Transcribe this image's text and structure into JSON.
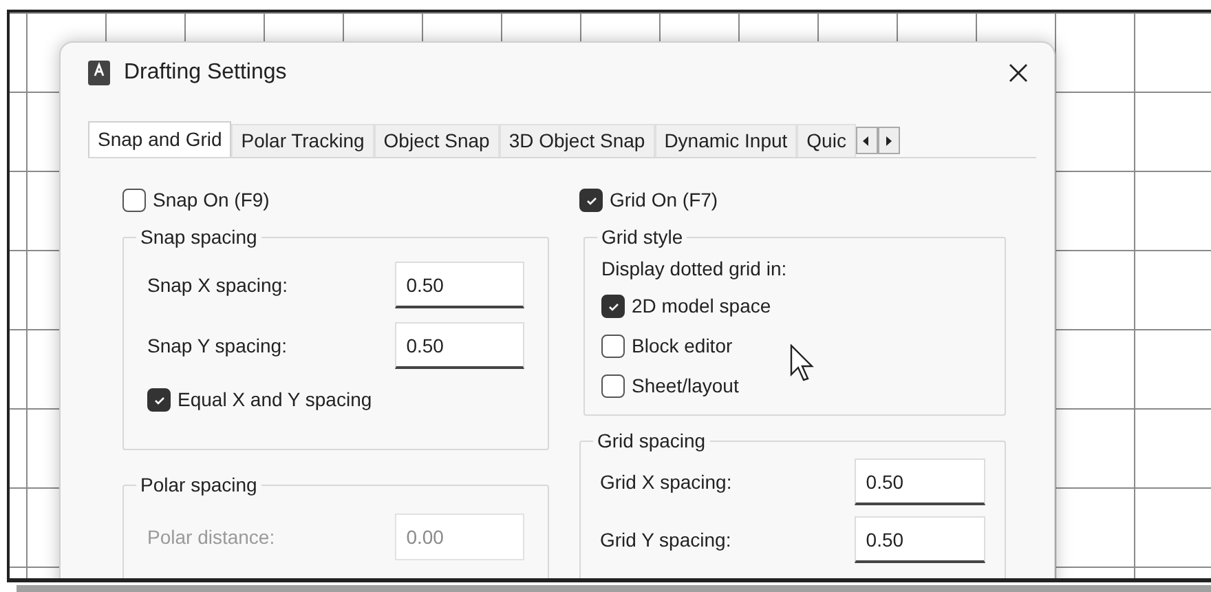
{
  "window": {
    "title": "Drafting Settings"
  },
  "tabs": [
    {
      "label": "Snap and Grid",
      "selected": true
    },
    {
      "label": "Polar Tracking",
      "selected": false
    },
    {
      "label": "Object Snap",
      "selected": false
    },
    {
      "label": "3D Object Snap",
      "selected": false
    },
    {
      "label": "Dynamic Input",
      "selected": false
    },
    {
      "label": "Quic",
      "selected": false
    }
  ],
  "snap_on": {
    "label": "Snap On (F9)",
    "checked": false
  },
  "snap_spacing": {
    "title": "Snap spacing",
    "fields": [
      {
        "label": "Snap X spacing:",
        "value": "0.50",
        "disabled": false
      },
      {
        "label": "Snap Y spacing:",
        "value": "0.50",
        "disabled": false
      }
    ],
    "equal": {
      "label": "Equal X and Y spacing",
      "checked": true
    }
  },
  "polar_spacing": {
    "title": "Polar spacing",
    "fields": [
      {
        "label": "Polar distance:",
        "value": "0.00",
        "disabled": true
      }
    ]
  },
  "grid_on": {
    "label": "Grid On (F7)",
    "checked": true
  },
  "grid_style": {
    "title": "Grid style",
    "caption": "Display dotted grid in:",
    "options": [
      {
        "label": "2D model space",
        "checked": true
      },
      {
        "label": "Block editor",
        "checked": false
      },
      {
        "label": "Sheet/layout",
        "checked": false
      }
    ]
  },
  "grid_spacing": {
    "title": "Grid spacing",
    "fields": [
      {
        "label": "Grid X spacing:",
        "value": "0.50",
        "disabled": false
      },
      {
        "label": "Grid Y spacing:",
        "value": "0.50",
        "disabled": false
      }
    ]
  }
}
